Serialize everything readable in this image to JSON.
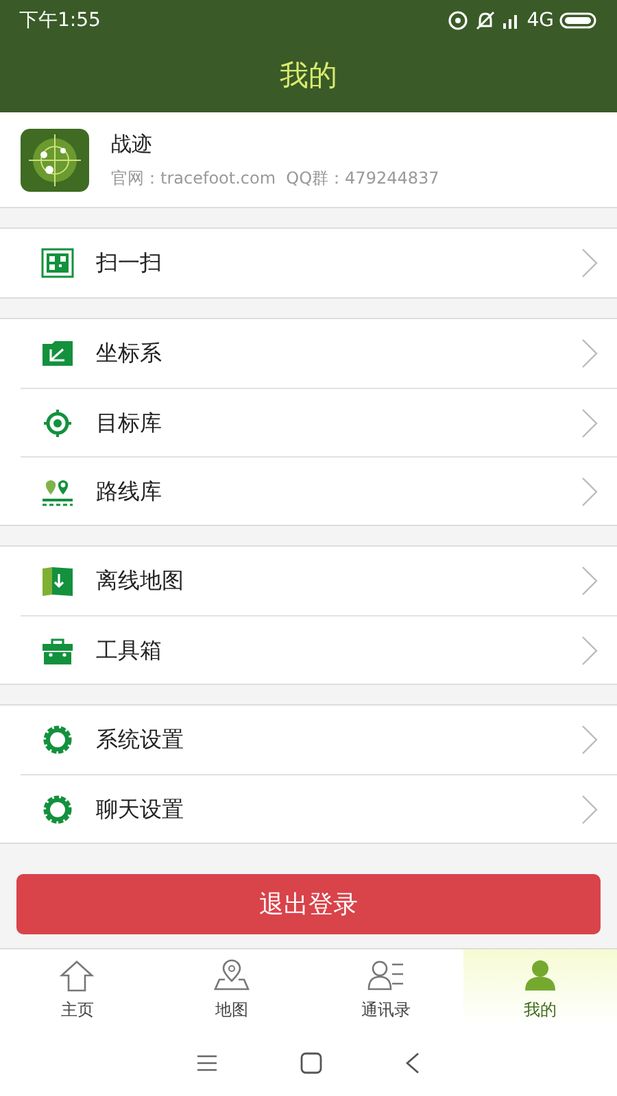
{
  "status_bar": {
    "time": "下午1:55",
    "network": "4G"
  },
  "header": {
    "title": "我的"
  },
  "profile": {
    "name": "战迹",
    "info": "官网：tracefoot.com  QQ群：479244837"
  },
  "menu_groups": [
    {
      "items": [
        {
          "kind": "scan",
          "label": "扫一扫"
        }
      ]
    },
    {
      "items": [
        {
          "kind": "axes",
          "label": "坐标系"
        },
        {
          "kind": "target",
          "label": "目标库"
        },
        {
          "kind": "route",
          "label": "路线库"
        }
      ]
    },
    {
      "items": [
        {
          "kind": "map",
          "label": "离线地图"
        },
        {
          "kind": "toolbox",
          "label": "工具箱"
        }
      ]
    },
    {
      "items": [
        {
          "kind": "gear",
          "label": "系统设置"
        },
        {
          "kind": "gear",
          "label": "聊天设置"
        }
      ]
    }
  ],
  "logout_button": "退出登录",
  "tabs": [
    {
      "kind": "home",
      "label": "主页",
      "selected": false
    },
    {
      "kind": "map",
      "label": "地图",
      "selected": false
    },
    {
      "kind": "contacts",
      "label": "通讯录",
      "selected": false
    },
    {
      "kind": "person",
      "label": "我的",
      "selected": true
    }
  ]
}
